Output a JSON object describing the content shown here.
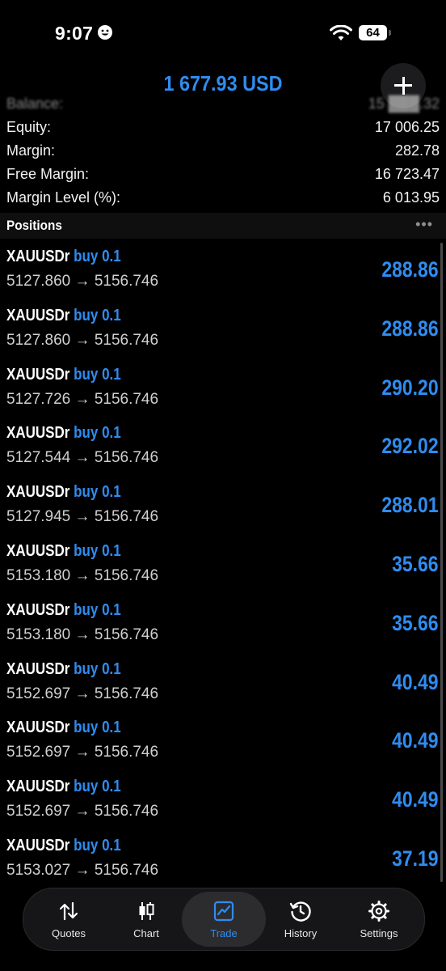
{
  "status": {
    "time": "9:07",
    "battery": "64"
  },
  "account": {
    "header_amount": "1 677.93 USD"
  },
  "summary": [
    {
      "label": "Balance:",
      "value": "15 ███.32"
    },
    {
      "label": "Equity:",
      "value": "17 006.25"
    },
    {
      "label": "Margin:",
      "value": "282.78"
    },
    {
      "label": "Free Margin:",
      "value": "16 723.47"
    },
    {
      "label": "Margin Level (%):",
      "value": "6 013.95"
    }
  ],
  "positions_header": {
    "title": "Positions",
    "menu": "•••"
  },
  "positions": [
    {
      "symbol": "XAUUSDr",
      "type": "buy 0.1",
      "open": "5127.860",
      "current": "5156.746",
      "profit": "288.86"
    },
    {
      "symbol": "XAUUSDr",
      "type": "buy 0.1",
      "open": "5127.860",
      "current": "5156.746",
      "profit": "288.86"
    },
    {
      "symbol": "XAUUSDr",
      "type": "buy 0.1",
      "open": "5127.726",
      "current": "5156.746",
      "profit": "290.20"
    },
    {
      "symbol": "XAUUSDr",
      "type": "buy 0.1",
      "open": "5127.544",
      "current": "5156.746",
      "profit": "292.02"
    },
    {
      "symbol": "XAUUSDr",
      "type": "buy 0.1",
      "open": "5127.945",
      "current": "5156.746",
      "profit": "288.01"
    },
    {
      "symbol": "XAUUSDr",
      "type": "buy 0.1",
      "open": "5153.180",
      "current": "5156.746",
      "profit": "35.66"
    },
    {
      "symbol": "XAUUSDr",
      "type": "buy 0.1",
      "open": "5153.180",
      "current": "5156.746",
      "profit": "35.66"
    },
    {
      "symbol": "XAUUSDr",
      "type": "buy 0.1",
      "open": "5152.697",
      "current": "5156.746",
      "profit": "40.49"
    },
    {
      "symbol": "XAUUSDr",
      "type": "buy 0.1",
      "open": "5152.697",
      "current": "5156.746",
      "profit": "40.49"
    },
    {
      "symbol": "XAUUSDr",
      "type": "buy 0.1",
      "open": "5152.697",
      "current": "5156.746",
      "profit": "40.49"
    },
    {
      "symbol": "XAUUSDr",
      "type": "buy 0.1",
      "open": "5153.027",
      "current": "5156.746",
      "profit": "37.19"
    }
  ],
  "tabs": [
    {
      "label": "Quotes",
      "icon": "quotes-arrows-icon"
    },
    {
      "label": "Chart",
      "icon": "candlestick-icon"
    },
    {
      "label": "Trade",
      "icon": "trade-chart-icon",
      "active": true
    },
    {
      "label": "History",
      "icon": "history-clock-icon"
    },
    {
      "label": "Settings",
      "icon": "gear-icon"
    }
  ],
  "colors": {
    "accent": "#2f8cf0",
    "background": "#000000"
  }
}
